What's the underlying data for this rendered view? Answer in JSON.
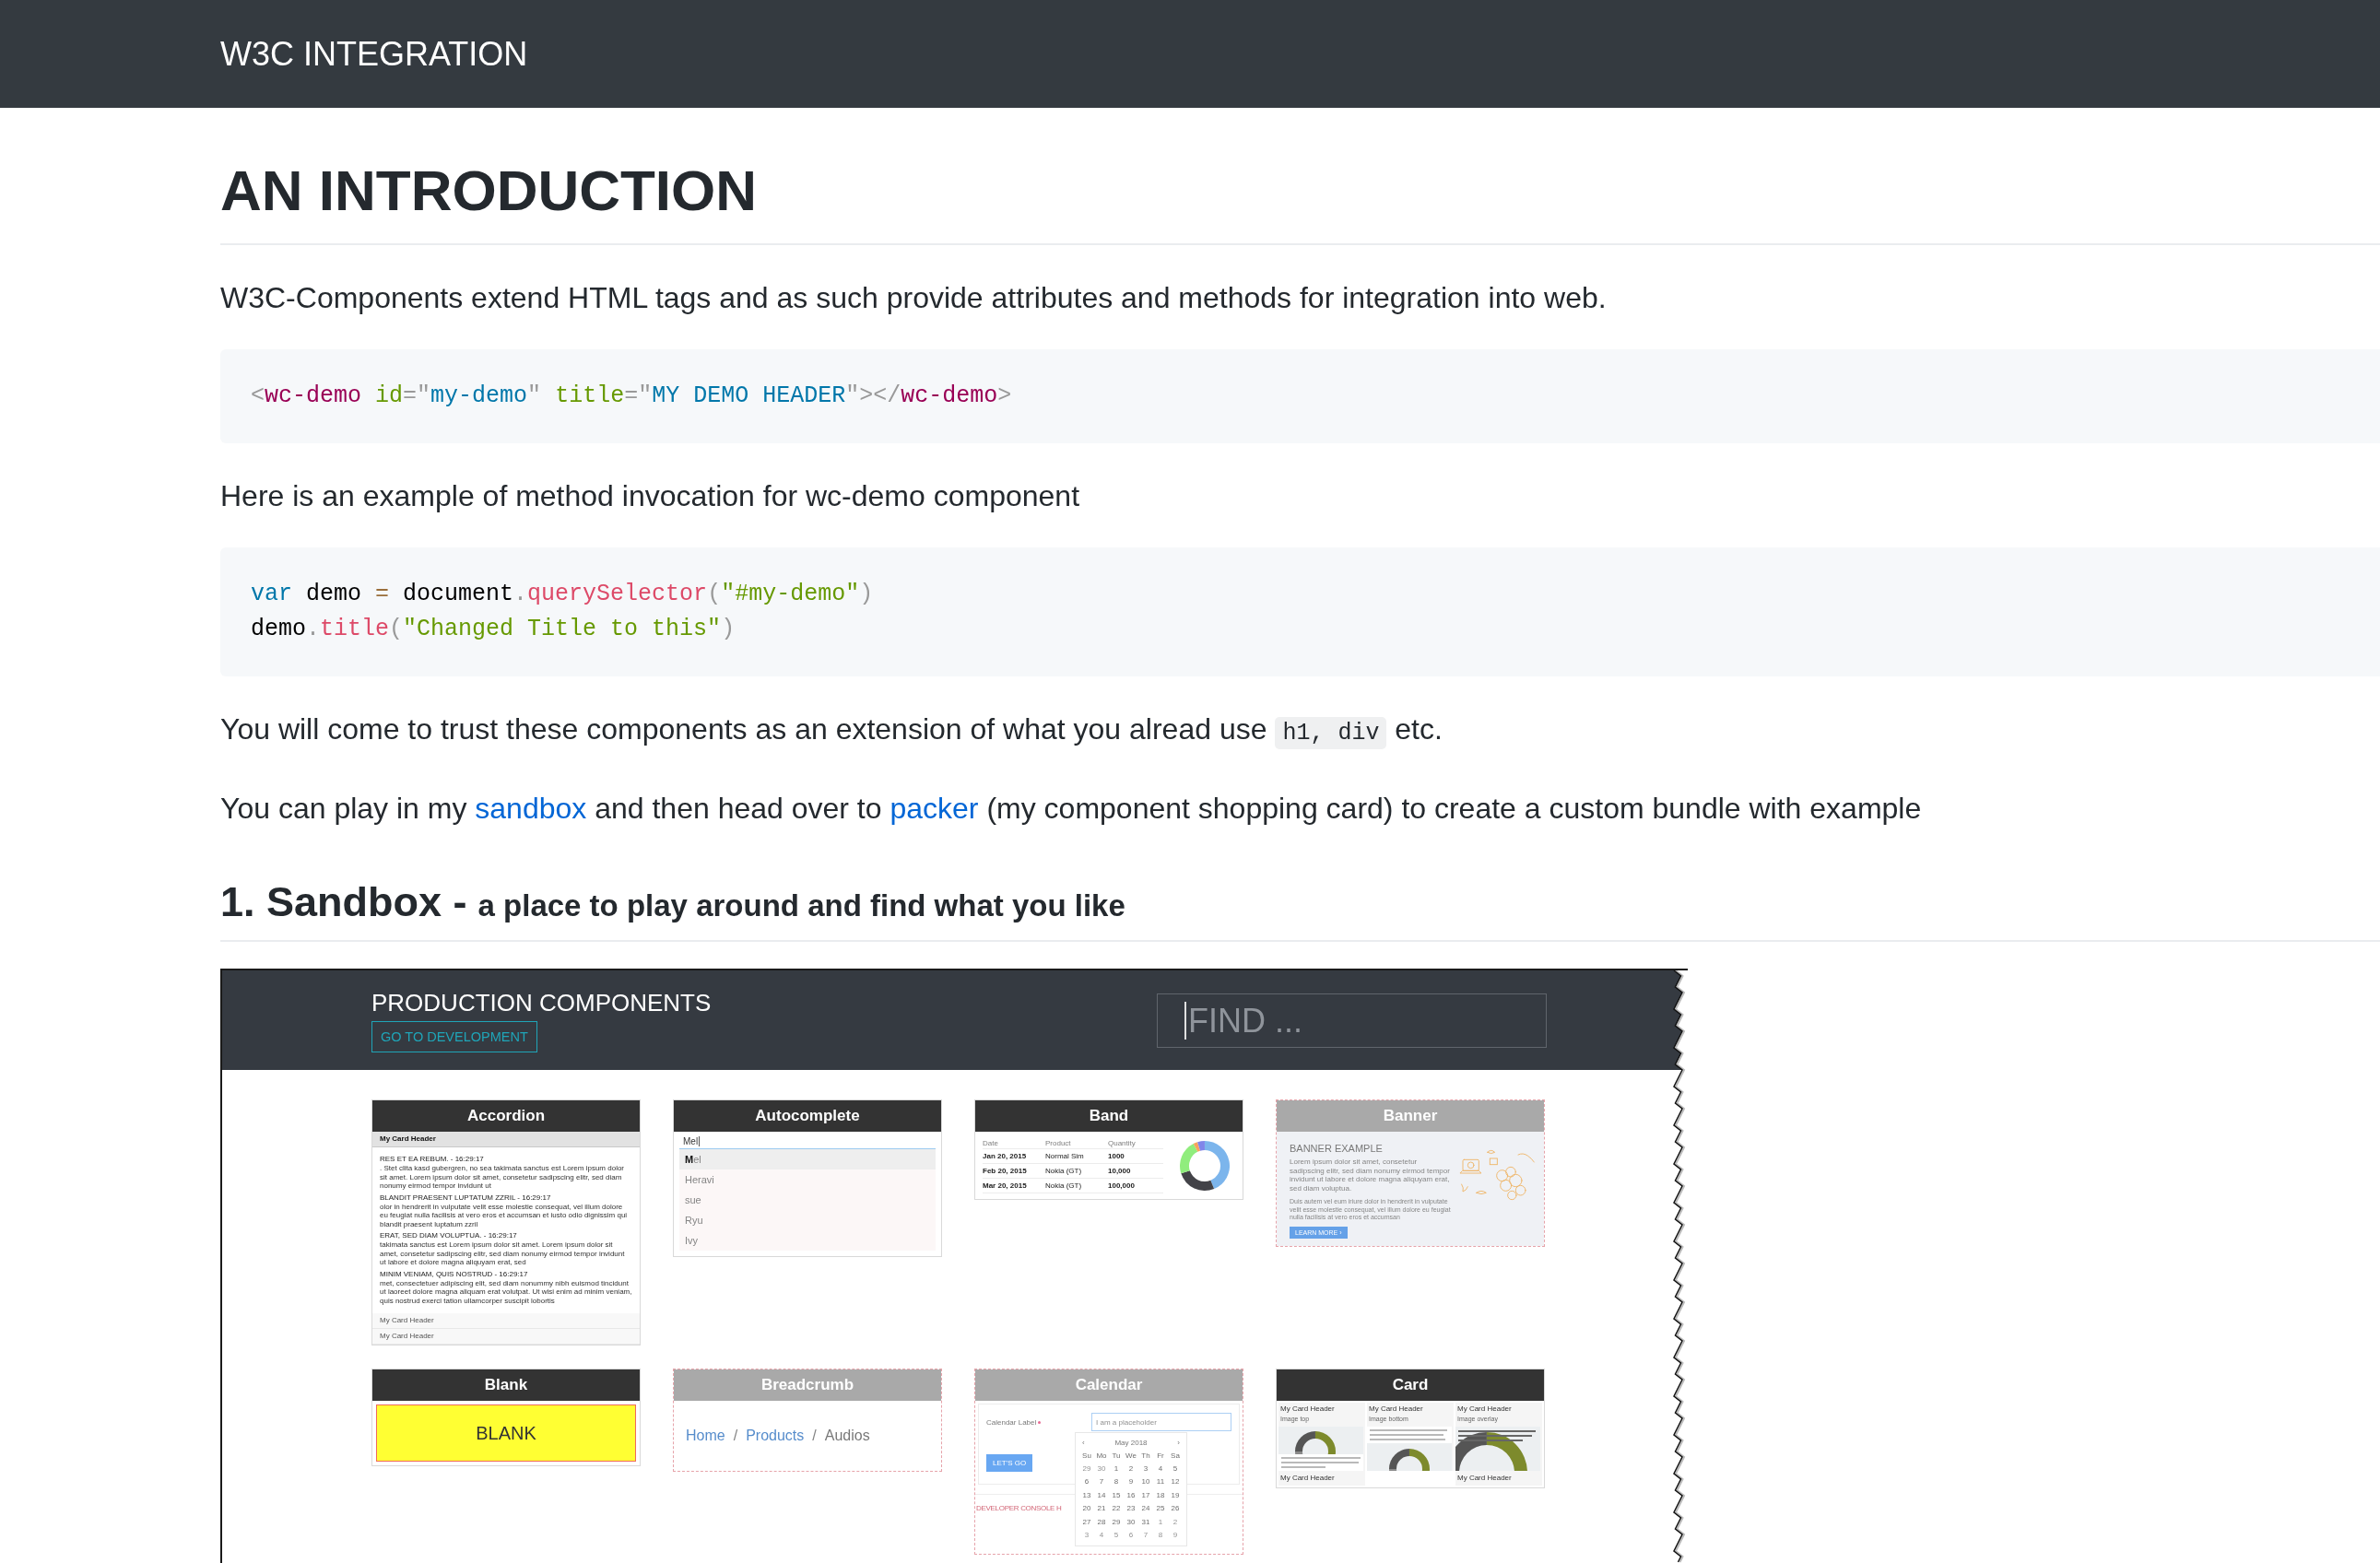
{
  "navbar": {
    "title": "W3C INTEGRATION"
  },
  "article": {
    "heading": "AN INTRODUCTION",
    "blocks": [
      {
        "kind": "paragraph",
        "parts": [
          {
            "kind": "text",
            "text": "W3C-Components extend HTML tags and as such provide attributes and methods for integration into web."
          }
        ]
      },
      {
        "kind": "code",
        "lines": [
          [
            {
              "kind": "punctuation",
              "text": "<"
            },
            {
              "kind": "tag",
              "text": "wc-demo"
            },
            {
              "kind": "attr-name",
              "text": " id"
            },
            {
              "kind": "punctuation",
              "text": "=\""
            },
            {
              "kind": "attr-value",
              "text": "my-demo"
            },
            {
              "kind": "punctuation",
              "text": "\""
            },
            {
              "kind": "attr-name",
              "text": " title"
            },
            {
              "kind": "punctuation",
              "text": "=\""
            },
            {
              "kind": "attr-value",
              "text": "MY DEMO HEADER"
            },
            {
              "kind": "punctuation",
              "text": "\"></"
            },
            {
              "kind": "tag",
              "text": "wc-demo"
            },
            {
              "kind": "punctuation",
              "text": ">"
            }
          ]
        ]
      },
      {
        "kind": "paragraph",
        "parts": [
          {
            "kind": "text",
            "text": "Here is an example of method invocation for wc-demo component"
          }
        ]
      },
      {
        "kind": "code",
        "lines": [
          [
            {
              "kind": "keyword",
              "text": "var"
            },
            {
              "kind": "plain",
              "text": " demo "
            },
            {
              "kind": "operator",
              "text": "="
            },
            {
              "kind": "plain",
              "text": " document"
            },
            {
              "kind": "punctuation",
              "text": "."
            },
            {
              "kind": "function",
              "text": "querySelector"
            },
            {
              "kind": "punctuation",
              "text": "("
            },
            {
              "kind": "string",
              "text": "\"#my-demo\""
            },
            {
              "kind": "punctuation",
              "text": ")"
            }
          ],
          [
            {
              "kind": "plain",
              "text": "demo"
            },
            {
              "kind": "punctuation",
              "text": "."
            },
            {
              "kind": "function",
              "text": "title"
            },
            {
              "kind": "punctuation",
              "text": "("
            },
            {
              "kind": "string",
              "text": "\"Changed Title to this\""
            },
            {
              "kind": "punctuation",
              "text": ")"
            }
          ]
        ]
      },
      {
        "kind": "paragraph",
        "parts": [
          {
            "kind": "text",
            "text": "You will come to trust these components as an extension of what you alread use "
          },
          {
            "kind": "code",
            "text": "h1, div"
          },
          {
            "kind": "text",
            "text": " etc."
          }
        ]
      },
      {
        "kind": "paragraph",
        "parts": [
          {
            "kind": "text",
            "text": "You can play in my "
          },
          {
            "kind": "link",
            "text": "sandbox"
          },
          {
            "kind": "text",
            "text": " and then head over to "
          },
          {
            "kind": "link",
            "text": "packer"
          },
          {
            "kind": "text",
            "text": " (my component shopping card) to create a custom bundle with example"
          }
        ]
      }
    ],
    "section": {
      "title": "1. Sandbox -",
      "subtitle": "a place to play around and find what you like"
    }
  },
  "sandbox_screenshot": {
    "title": "PRODUCTION COMPONENTS",
    "dev_button": "GO TO DEVELOPMENT",
    "search": {
      "placeholder": "FIND ..."
    },
    "cards": [
      {
        "kind": "accordion",
        "title": "Accordion",
        "disabled": false,
        "sections": [
          {
            "header": "My Card Header",
            "expanded": true,
            "entries": [
              {
                "title": "RES ET EA REBUM. - 16:29:17",
                "text": ". Stet clita kasd gubergren, no sea takimata sanctus est Lorem ipsum dolor sit amet. Lorem ipsum dolor sit amet, consetetur sadipscing elitr, sed diam nonumy eirmod tempor invidunt ut"
              },
              {
                "title": "BLANDIT PRAESENT LUPTATUM ZZRIL - 16:29:17",
                "text": "olor in hendrerit in vulputate velit esse molestie consequat, vel illum dolore eu feugiat nulla facilisis at vero eros et accumsan et iusto odio dignissim qui blandit praesent luptatum zzril"
              },
              {
                "title": "ERAT, SED DIAM VOLUPTUA. - 16:29:17",
                "text": "takimata sanctus est Lorem ipsum dolor sit amet. Lorem ipsum dolor sit amet, consetetur sadipscing elitr, sed diam nonumy eirmod tempor invidunt ut labore et dolore magna aliquyam erat, sed"
              },
              {
                "title": "MINIM VENIAM, QUIS NOSTRUD - 16:29:17",
                "text": "met, consectetuer adipiscing elit, sed diam nonummy nibh euismod tincidunt ut laoreet dolore magna aliquam erat volutpat. Ut wisi enim ad minim veniam, quis nostrud exerci tation ullamcorper suscipit lobortis"
              }
            ]
          },
          {
            "header": "My Card Header",
            "expanded": false
          },
          {
            "header": "My Card Header",
            "expanded": false
          }
        ]
      },
      {
        "kind": "autocomplete",
        "title": "Autocomplete",
        "disabled": false,
        "value": "Mel",
        "options": [
          {
            "label": "**M**el",
            "selected": true
          },
          {
            "label": "Heravi",
            "selected": false
          },
          {
            "label": "sue",
            "selected": false
          },
          {
            "label": "Ryu",
            "selected": false
          },
          {
            "label": "Ivy",
            "selected": false
          }
        ]
      },
      {
        "kind": "band",
        "title": "Band",
        "disabled": false,
        "columns": [
          "Date",
          "Product",
          "Quantity"
        ],
        "rows": [
          [
            "Jan 20, 2015",
            "Normal Sim",
            "1000"
          ],
          [
            "Feb 20, 2015",
            "Nokia (GT)",
            "10,000"
          ],
          [
            "Mar 20, 2015",
            "Nokia (GT)",
            "100,000"
          ]
        ]
      },
      {
        "kind": "banner",
        "title": "Banner",
        "disabled": true,
        "heading": "BANNER EXAMPLE",
        "text": "Lorem ipsum dolor sit amet, consetetur sadipscing elitr, sed diam nonumy eirmod tempor invidunt ut labore et dolore magna aliquyam erat, sed diam voluptua.",
        "note": "Duis autem vel eum iriure dolor in hendrerit in vulputate velit esse molestie consequat, vel illum dolore eu feugiat nulla facilisis at vero eros et accumsan",
        "button": "LEARN MORE ›"
      },
      {
        "kind": "blank",
        "title": "Blank",
        "disabled": false,
        "label": "BLANK"
      },
      {
        "kind": "breadcrumb",
        "title": "Breadcrumb",
        "disabled": true,
        "items": [
          {
            "kind": "link",
            "label": "Home"
          },
          {
            "kind": "separator",
            "label": "/"
          },
          {
            "kind": "link",
            "label": "Products"
          },
          {
            "kind": "separator",
            "label": "/"
          },
          {
            "kind": "current",
            "label": "Audios"
          }
        ]
      },
      {
        "kind": "calendar",
        "title": "Calendar",
        "disabled": true,
        "label": "Calendar Label",
        "required": true,
        "placeholder": "I am a placeholder",
        "button": "LET'S GO",
        "console": "DEVELOPER CONSOLE H",
        "picker": {
          "prev": "‹",
          "month": "May 2018",
          "next": "›",
          "weekdays": [
            "Su",
            "Mo",
            "Tu",
            "We",
            "Th",
            "Fr",
            "Sa"
          ],
          "weeks": [
            [
              {
                "day": "29",
                "other_month": true
              },
              {
                "day": "30",
                "other_month": true
              },
              {
                "day": "1",
                "other_month": false
              },
              {
                "day": "2",
                "other_month": false
              },
              {
                "day": "3",
                "other_month": false
              },
              {
                "day": "4",
                "other_month": false
              },
              {
                "day": "5",
                "other_month": false
              }
            ],
            [
              {
                "day": "6",
                "other_month": false
              },
              {
                "day": "7",
                "other_month": false
              },
              {
                "day": "8",
                "other_month": false
              },
              {
                "day": "9",
                "other_month": false
              },
              {
                "day": "10",
                "other_month": false
              },
              {
                "day": "11",
                "other_month": false
              },
              {
                "day": "12",
                "other_month": false
              }
            ],
            [
              {
                "day": "13",
                "other_month": false
              },
              {
                "day": "14",
                "other_month": false
              },
              {
                "day": "15",
                "other_month": false
              },
              {
                "day": "16",
                "other_month": false
              },
              {
                "day": "17",
                "other_month": false
              },
              {
                "day": "18",
                "other_month": false
              },
              {
                "day": "19",
                "other_month": false
              }
            ],
            [
              {
                "day": "20",
                "other_month": false
              },
              {
                "day": "21",
                "other_month": false
              },
              {
                "day": "22",
                "other_month": false
              },
              {
                "day": "23",
                "other_month": false
              },
              {
                "day": "24",
                "other_month": false
              },
              {
                "day": "25",
                "other_month": false
              },
              {
                "day": "26",
                "other_month": false
              }
            ],
            [
              {
                "day": "27",
                "other_month": false
              },
              {
                "day": "28",
                "other_month": false
              },
              {
                "day": "29",
                "other_month": false
              },
              {
                "day": "30",
                "other_month": false
              },
              {
                "day": "31",
                "other_month": false
              },
              {
                "day": "1",
                "other_month": true
              },
              {
                "day": "2",
                "other_month": true
              }
            ],
            [
              {
                "day": "3",
                "other_month": true
              },
              {
                "day": "4",
                "other_month": true
              },
              {
                "day": "5",
                "other_month": true
              },
              {
                "day": "6",
                "other_month": true
              },
              {
                "day": "7",
                "other_month": true
              },
              {
                "day": "8",
                "other_month": true
              },
              {
                "day": "9",
                "other_month": true
              }
            ]
          ]
        }
      },
      {
        "kind": "card",
        "title": "Card",
        "disabled": false,
        "panels": [
          {
            "kind": "image-top",
            "header": "My Card Header",
            "note": "Image top",
            "footer": "My Card Header"
          },
          {
            "kind": "image-bottom",
            "header": "My Card Header",
            "note": "Image bottom"
          },
          {
            "kind": "image-overlay",
            "header": "My Card Header",
            "note": "Image overlay",
            "footer": "My Card Header"
          }
        ]
      }
    ]
  }
}
